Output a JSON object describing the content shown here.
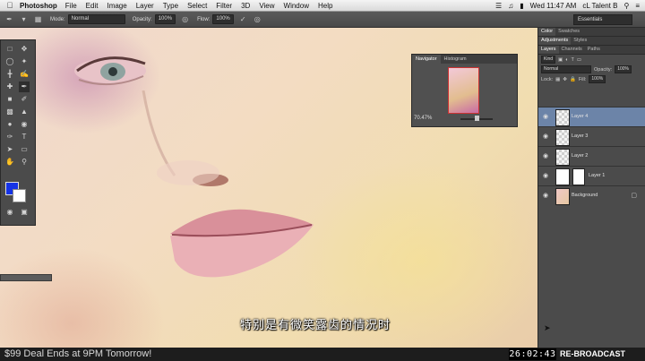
{
  "menubar": {
    "app_name": "Photoshop",
    "menus": [
      "File",
      "Edit",
      "Image",
      "Layer",
      "Type",
      "Select",
      "Filter",
      "3D",
      "View",
      "Window",
      "Help"
    ],
    "clock": "Wed 11:47 AM",
    "user": "cL Talent B"
  },
  "options_bar": {
    "mode_label": "Mode:",
    "mode_value": "Normal",
    "opacity_label": "Opacity:",
    "opacity_value": "100%",
    "flow_label": "Flow:",
    "flow_value": "100%",
    "workspace": "Essentials"
  },
  "navigator": {
    "tabs": [
      "Navigator",
      "Histogram"
    ],
    "zoom": "70.47%"
  },
  "right_panel": {
    "top_tabs": [
      "Color",
      "Swatches"
    ],
    "mid_tabs": [
      "Adjustments",
      "Styles"
    ],
    "layers_tabs": [
      "Layers",
      "Channels",
      "Paths"
    ],
    "kind_label": "Kind",
    "blend_mode": "Normal",
    "opacity_label": "Opacity:",
    "opacity_value": "100%",
    "lock_label": "Lock:",
    "fill_label": "Fill:",
    "fill_value": "100%",
    "layers": [
      {
        "name": "Layer 4",
        "selected": true
      },
      {
        "name": "Layer 3",
        "selected": false
      },
      {
        "name": "Layer 2",
        "selected": false
      },
      {
        "name": "Layer 1",
        "selected": false
      },
      {
        "name": "Background",
        "selected": false
      }
    ]
  },
  "subtitle": "特别是有微笑露齿的情况时",
  "promo": {
    "deal_text": "$99 Deal Ends at 9PM Tomorrow!",
    "timer": "26:02:43",
    "rebroadcast": "RE-BROADCAST"
  },
  "colors": {
    "foreground": "#1533e6",
    "background": "#ffffff",
    "selected_layer": "#6c84a8"
  }
}
